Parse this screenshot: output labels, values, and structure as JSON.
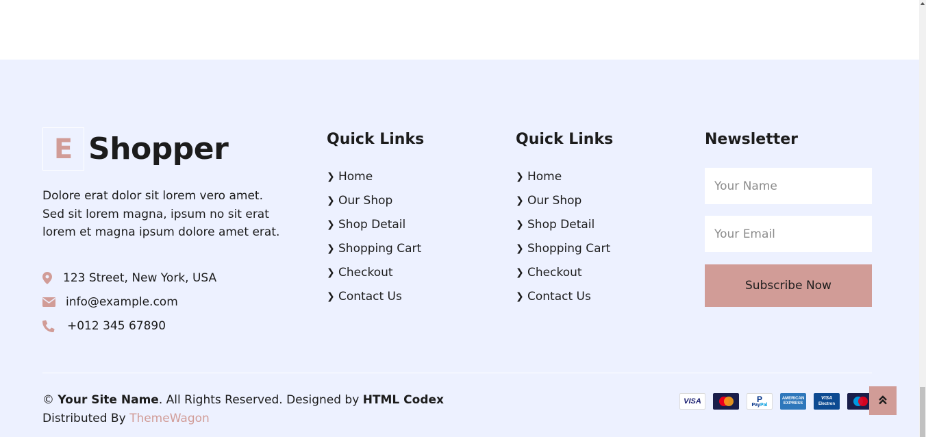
{
  "brand": {
    "letter": "E",
    "name": "Shopper"
  },
  "about": {
    "text": "Dolore erat dolor sit lorem vero amet. Sed sit lorem magna, ipsum no sit erat lorem et magna ipsum dolore amet erat."
  },
  "contact": {
    "address": "123 Street, New York, USA",
    "email": "info@example.com",
    "phone": "+012 345 67890"
  },
  "quick_links_1": {
    "title": "Quick Links",
    "items": [
      "Home",
      "Our Shop",
      "Shop Detail",
      "Shopping Cart",
      "Checkout",
      "Contact Us"
    ]
  },
  "quick_links_2": {
    "title": "Quick Links",
    "items": [
      "Home",
      "Our Shop",
      "Shop Detail",
      "Shopping Cart",
      "Checkout",
      "Contact Us"
    ]
  },
  "newsletter": {
    "title": "Newsletter",
    "name_placeholder": "Your Name",
    "email_placeholder": "Your Email",
    "button_label": "Subscribe Now"
  },
  "copyright": {
    "symbol": "©",
    "site_name": "Your Site Name",
    "rights": ". All Rights Reserved. Designed by ",
    "designer": "HTML Codex",
    "distributed_label": "Distributed By ",
    "distributor": "ThemeWagon"
  },
  "payments": {
    "visa": "VISA",
    "mastercard": "MasterCard",
    "paypal_1": "Pay",
    "paypal_2": "Pal",
    "amex": "AMERICAN EXPRESS",
    "visa_electron_1": "VISA",
    "visa_electron_2": "Electron",
    "maestro": "Maestro"
  },
  "colors": {
    "accent": "#d19c97",
    "footer_bg": "#edf1ff",
    "text": "#1c1c1c"
  },
  "icons": {
    "address": "map-marker-icon",
    "email": "envelope-icon",
    "phone": "phone-icon",
    "link": "chevron-right-icon",
    "back_to_top": "double-chevron-up-icon"
  }
}
